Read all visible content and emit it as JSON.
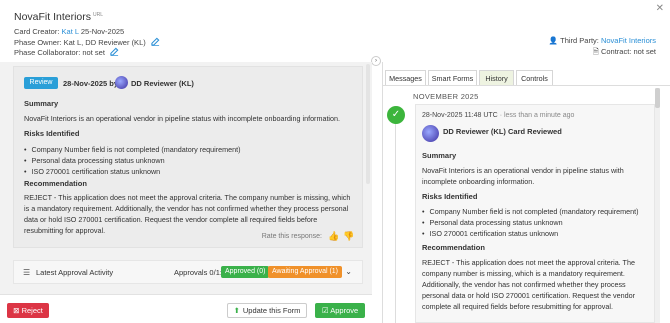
{
  "header": {
    "title": "NovaFit Interiors",
    "title_sub": "URL",
    "card_creator_label": "Card Creator:",
    "card_creator_name": "Kat L",
    "card_creator_date": "25-Nov-2025",
    "phase_owner_label": "Phase Owner:",
    "phase_owner_value": "Kat L, DD Reviewer (KL)",
    "phase_collab_label": "Phase Collaborator:",
    "phase_collab_value": "not set",
    "third_party_label": "Third Party:",
    "third_party_value": "NovaFit Interiors",
    "contract_label": "Contract:",
    "contract_value": "not set",
    "close_icon": "close-icon"
  },
  "review_card": {
    "tag": "Review",
    "date": "28-Nov-2025 by",
    "reviewer": "DD Reviewer (KL)",
    "summary_heading": "Summary",
    "summary_text": "NovaFit Interiors is an operational vendor in pipeline status with incomplete onboarding information.",
    "risks_heading": "Risks Identified",
    "risks": [
      "Company Number field is not completed (mandatory requirement)",
      "Personal data processing status unknown",
      "ISO 270001 certification status unknown"
    ],
    "recommendation_heading": "Recommendation",
    "recommendation_text": "REJECT - This application does not meet the approval criteria. The company number is missing, which is a mandatory requirement. Additionally, the vendor has not confirmed whether they process personal data or hold ISO 270001 certification. Request the vendor complete all required fields before resubmitting for approval.",
    "rate_label": "Rate this response:"
  },
  "activity": {
    "label": "Latest Approval Activity",
    "approvals": "Approvals 0/1:",
    "approved": "Approved (0)",
    "awaiting": "Awaiting Approval (1)"
  },
  "footer": {
    "reject": "Reject",
    "update": "Update this Form",
    "approve": "Approve"
  },
  "tabs": [
    {
      "label": "Messages"
    },
    {
      "label": "Smart Forms"
    },
    {
      "label": "History"
    },
    {
      "label": "Controls"
    }
  ],
  "history": {
    "month": "NOVEMBER 2025",
    "time": "28-Nov-2025 11:48 UTC",
    "ago": "· less than a minute ago",
    "entry_title": "DD Reviewer (KL) Card Reviewed",
    "summary_heading": "Summary",
    "summary_text": "NovaFit Interiors is an operational vendor in pipeline status with incomplete onboarding information.",
    "risks_heading": "Risks Identified",
    "risks": [
      "Company Number field is not completed (mandatory requirement)",
      "Personal data processing status unknown",
      "ISO 270001 certification status unknown"
    ],
    "recommendation_heading": "Recommendation",
    "recommendation_text": "REJECT - This application does not meet the approval criteria. The company number is missing, which is a mandatory requirement. Additionally, the vendor has not confirmed whether they process personal data or hold ISO 270001 certification. Request the vendor complete all required fields before resubmitting for approval."
  },
  "colors": {
    "accent_blue": "#2a9fd8",
    "link_blue": "#2a8fd6",
    "green": "#3ab14a",
    "orange": "#f0912a",
    "red": "#dc3545"
  }
}
